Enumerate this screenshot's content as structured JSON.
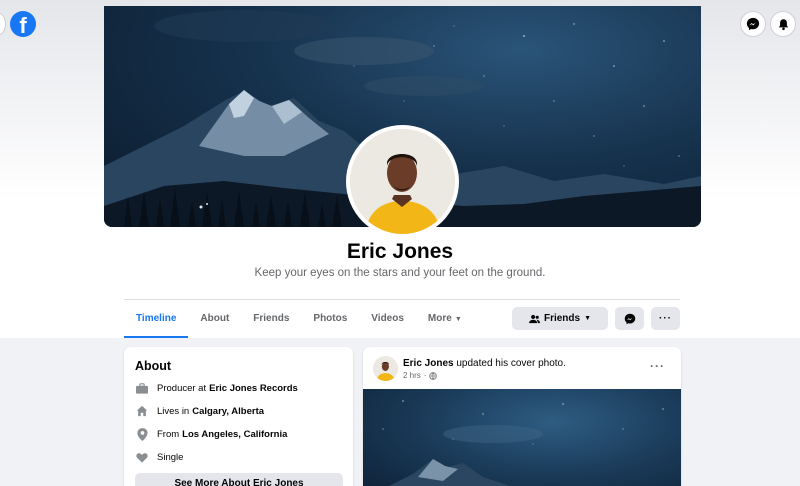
{
  "profile": {
    "name": "Eric Jones",
    "bio": "Keep your eyes on the stars and your feet on the ground."
  },
  "tabs": [
    {
      "label": "Timeline"
    },
    {
      "label": "About"
    },
    {
      "label": "Friends"
    },
    {
      "label": "Photos"
    },
    {
      "label": "Videos"
    },
    {
      "label": "More",
      "icon": "caret-down-icon"
    }
  ],
  "actions": {
    "friends_label": "Friends"
  },
  "about": {
    "title": "About",
    "rows": [
      {
        "icon": "briefcase-icon",
        "prefix": "Producer at",
        "bold": "Eric Jones Records"
      },
      {
        "icon": "home-icon",
        "prefix": "Lives in",
        "bold": "Calgary, Alberta"
      },
      {
        "icon": "location-pin-icon",
        "prefix": "From",
        "bold": "Los Angeles, California"
      },
      {
        "icon": "heart-icon",
        "prefix": "Single",
        "bold": ""
      }
    ],
    "see_more": "See More About Eric Jones"
  },
  "post": {
    "author": "Eric Jones",
    "action": "updated his cover photo.",
    "time": "2 hrs",
    "dots": "···"
  },
  "colors": {
    "accent": "#1877f2",
    "background": "#f0f2f5",
    "button_gray": "#e4e6eb"
  }
}
